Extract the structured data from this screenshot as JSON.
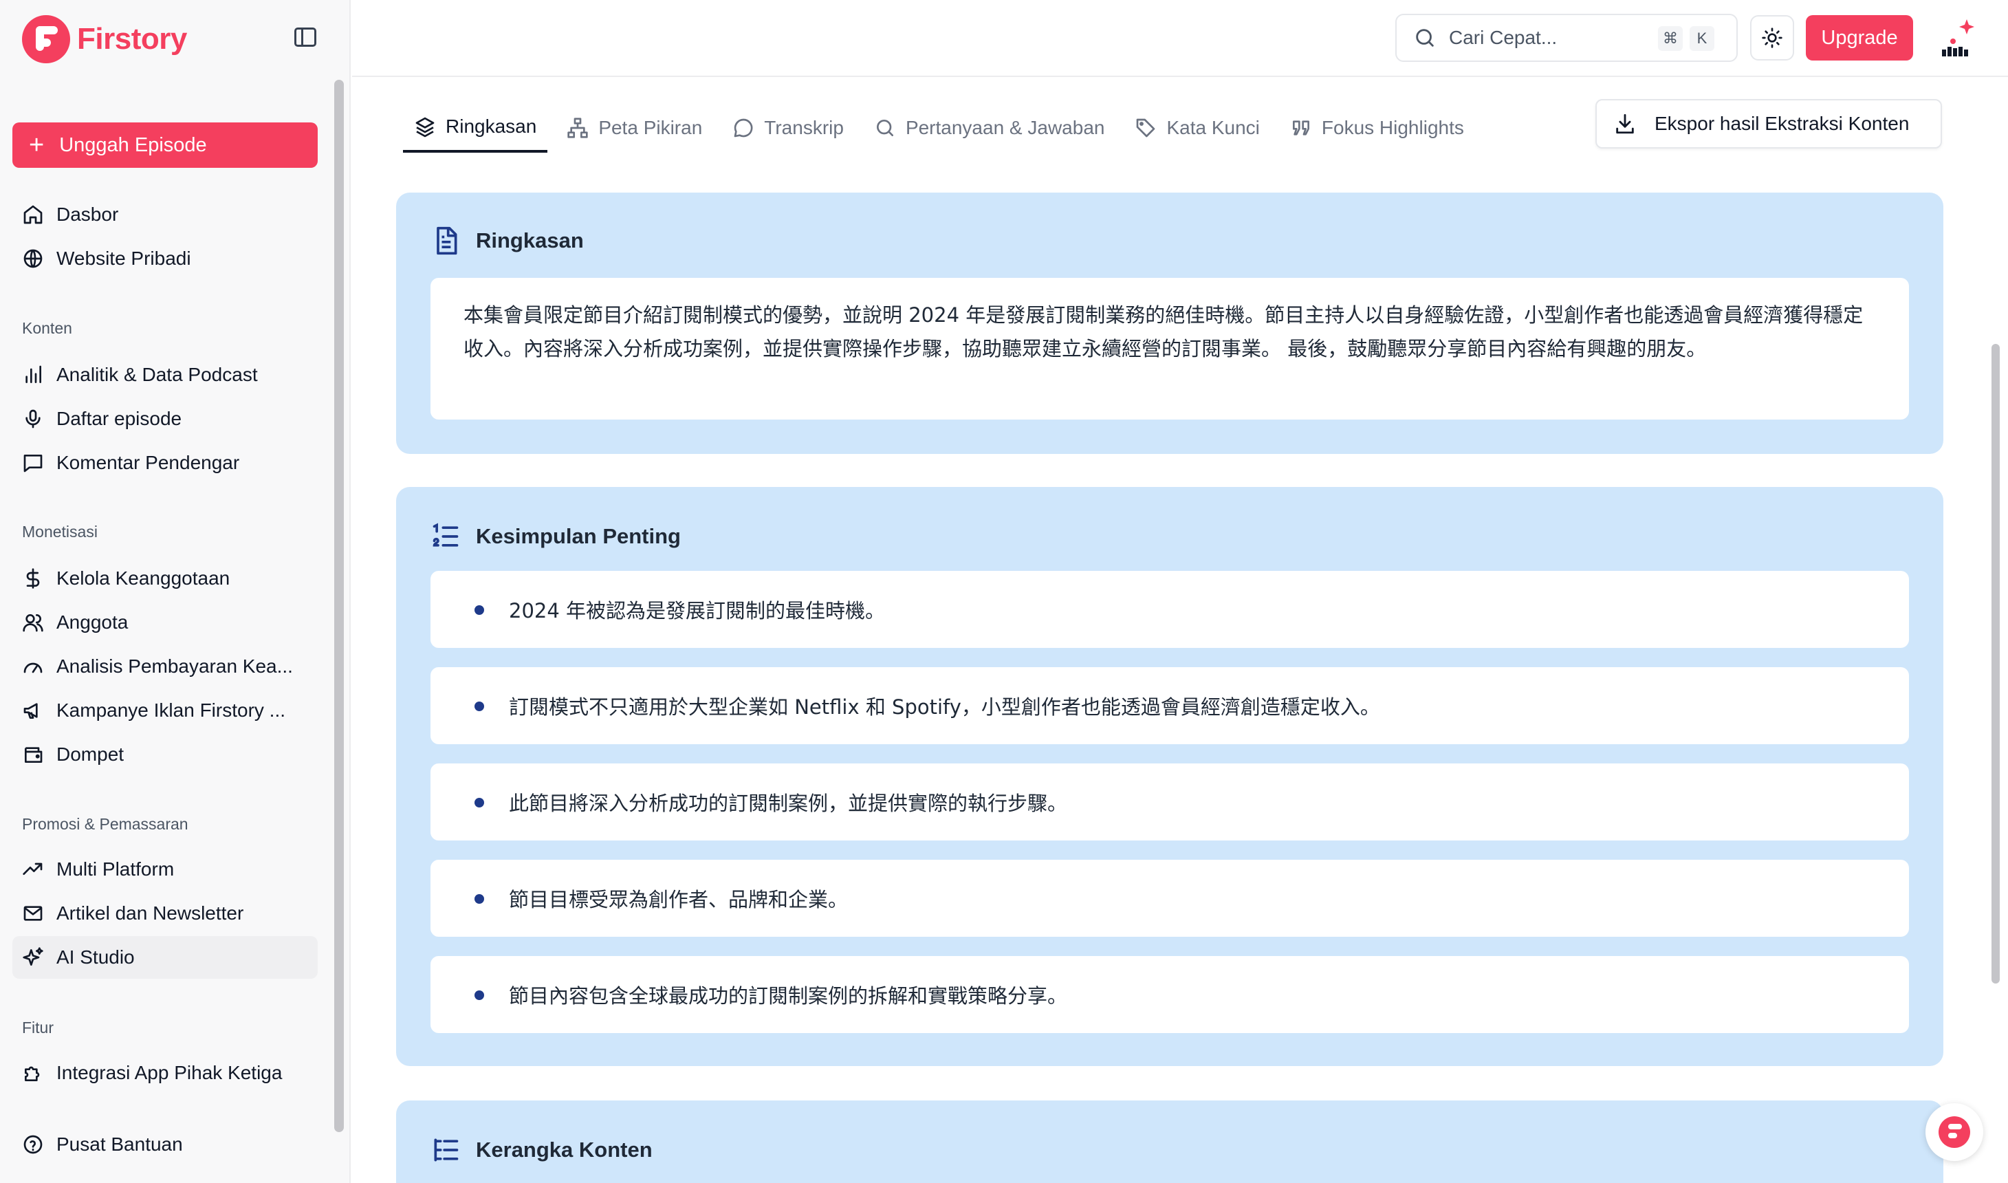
{
  "app": {
    "name": "Firstory",
    "brand_color": "#f43f5e"
  },
  "sidebar": {
    "upload_label": "Unggah Episode",
    "top_items": [
      {
        "label": "Dasbor",
        "icon": "home-icon"
      },
      {
        "label": "Website Pribadi",
        "icon": "globe-icon"
      }
    ],
    "sections": [
      {
        "title": "Konten",
        "items": [
          {
            "label": "Analitik & Data Podcast",
            "icon": "bar-chart-icon"
          },
          {
            "label": "Daftar episode",
            "icon": "microphone-icon"
          },
          {
            "label": "Komentar Pendengar",
            "icon": "message-square-icon"
          }
        ]
      },
      {
        "title": "Monetisasi",
        "items": [
          {
            "label": "Kelola Keanggotaan",
            "icon": "dollar-icon"
          },
          {
            "label": "Anggota",
            "icon": "users-icon"
          },
          {
            "label": "Analisis Pembayaran Kea...",
            "icon": "gauge-icon"
          },
          {
            "label": "Kampanye Iklan Firstory ...",
            "icon": "megaphone-icon"
          },
          {
            "label": "Dompet",
            "icon": "wallet-icon"
          }
        ]
      },
      {
        "title": "Promosi & Pemassaran",
        "items": [
          {
            "label": "Multi Platform",
            "icon": "trending-up-icon"
          },
          {
            "label": "Artikel dan Newsletter",
            "icon": "mail-icon"
          },
          {
            "label": "AI Studio",
            "icon": "sparkles-icon",
            "active": true
          }
        ]
      },
      {
        "title": "Fitur",
        "items": [
          {
            "label": "Integrasi App Pihak Ketiga",
            "icon": "puzzle-icon"
          }
        ]
      }
    ],
    "help_label": "Pusat Bantuan"
  },
  "header": {
    "search_placeholder": "Cari Cepat...",
    "shortcut_keys": [
      "⌘",
      "K"
    ],
    "upgrade_label": "Upgrade"
  },
  "tabs": [
    {
      "label": "Ringkasan",
      "icon": "layers-icon",
      "active": true
    },
    {
      "label": "Peta Pikiran",
      "icon": "sitemap-icon"
    },
    {
      "label": "Transkrip",
      "icon": "chat-bubble-icon"
    },
    {
      "label": "Pertanyaan & Jawaban",
      "icon": "search-icon"
    },
    {
      "label": "Kata Kunci",
      "icon": "tag-icon"
    },
    {
      "label": "Fokus Highlights",
      "icon": "quote-icon"
    }
  ],
  "export_label": "Ekspor hasil Ekstraksi Konten",
  "summary": {
    "title": "Ringkasan",
    "text": "本集會員限定節目介紹訂閱制模式的優勢，並說明 2024 年是發展訂閱制業務的絕佳時機。節目主持人以自身經驗佐證，小型創作者也能透過會員經濟獲得穩定收入。內容將深入分析成功案例，並提供實際操作步驟，協助聽眾建立永續經營的訂閱事業。 最後，鼓勵聽眾分享節目內容給有興趣的朋友。"
  },
  "key_points": {
    "title": "Kesimpulan Penting",
    "items": [
      "2024 年被認為是發展訂閱制的最佳時機。",
      "訂閱模式不只適用於大型企業如 Netflix 和 Spotify，小型創作者也能透過會員經濟創造穩定收入。",
      "此節目將深入分析成功的訂閱制案例，並提供實際的執行步驟。",
      "節目目標受眾為創作者、品牌和企業。",
      "節目內容包含全球最成功的訂閱制案例的拆解和實戰策略分享。"
    ]
  },
  "outline": {
    "title": "Kerangka Konten"
  }
}
